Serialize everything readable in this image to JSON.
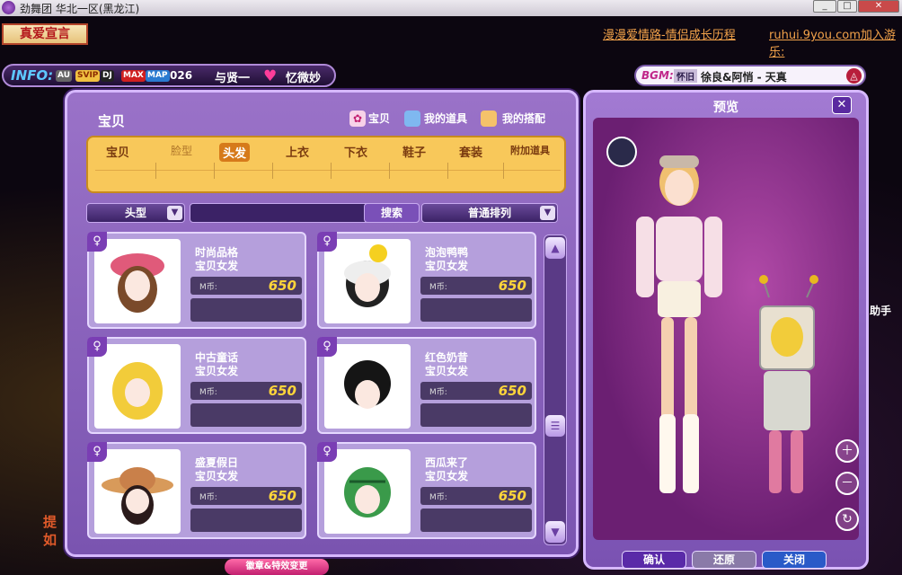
{
  "window": {
    "title": "劲舞团 华北一区(黑龙江)",
    "buttons": [
      "_",
      "□",
      "✕"
    ]
  },
  "top": {
    "declaration": "真爱宣言",
    "link1": "漫漫爱情路-情侣成长历程",
    "link2": "ruhui.9you.com加入游乐:"
  },
  "info": {
    "label": "INFO:",
    "badges": [
      "AU",
      "SVIP",
      "DJ",
      "MAX",
      "MAP"
    ],
    "number": "026",
    "text": "与贤一",
    "partner": "忆微妙"
  },
  "bgm": {
    "label": "BGM:",
    "tag": "怀旧",
    "song": "徐良&阿悄 - 天真"
  },
  "panel": {
    "title": "宝贝",
    "tabs": [
      {
        "label": "宝贝",
        "icon": "paw-icon"
      },
      {
        "label": "我的道具",
        "icon": "box-icon"
      },
      {
        "label": "我的搭配",
        "icon": "hand-icon"
      }
    ],
    "categories": [
      "宝贝",
      "脸型",
      "头发",
      "上衣",
      "下衣",
      "鞋子",
      "套装",
      "附加道具"
    ],
    "filter": "头型",
    "search_btn": "搜索",
    "sort": "普通排列",
    "currency_label": "M币:",
    "items": [
      {
        "name": "时尚品格",
        "sub": "宝贝女发",
        "price": "650"
      },
      {
        "name": "泡泡鸭鸭",
        "sub": "宝贝女发",
        "price": "650"
      },
      {
        "name": "中古童话",
        "sub": "宝贝女发",
        "price": "650"
      },
      {
        "name": "红色奶昔",
        "sub": "宝贝女发",
        "price": "650"
      },
      {
        "name": "盛夏假日",
        "sub": "宝贝女发",
        "price": "650"
      },
      {
        "name": "西瓜来了",
        "sub": "宝贝女发",
        "price": "650"
      }
    ]
  },
  "preview": {
    "title": "预览",
    "confirm": "确认",
    "reset": "还原",
    "close": "关闭"
  },
  "bottom": {
    "chip": "徽章&特效变更",
    "left1": "提",
    "left2": "如"
  },
  "right_text": "助手"
}
